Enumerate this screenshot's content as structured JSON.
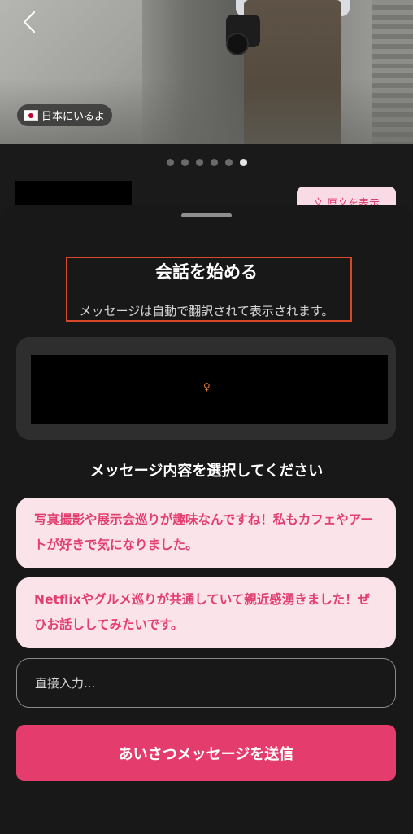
{
  "profile": {
    "location_flag_icon": "japan-flag-icon",
    "location_text": "日本にいるよ",
    "photo_count": 6,
    "active_photo_index": 5,
    "translate_button_label": "原文を表示"
  },
  "sheet": {
    "title": "会話を始める",
    "subtitle": "メッセージは自動で翻訳されて表示されます。",
    "gender_symbol": "♀",
    "choose_label": "メッセージ内容を選択してください",
    "options": [
      {
        "text": "写真撮影や展示会巡りが趣味なんですね！私もカフェやアートが好きで気になりました。"
      },
      {
        "text": "Netflixやグルメ巡りが共通していて親近感湧きました！ぜひお話ししてみたいです。"
      }
    ],
    "direct_input_placeholder": "直接入力...",
    "send_button_label": "あいさつメッセージを送信"
  },
  "colors": {
    "accent": "#e43d6d",
    "option_bg": "#fbe3ea",
    "sheet_bg": "#181818",
    "highlight_border": "#d9472b"
  }
}
